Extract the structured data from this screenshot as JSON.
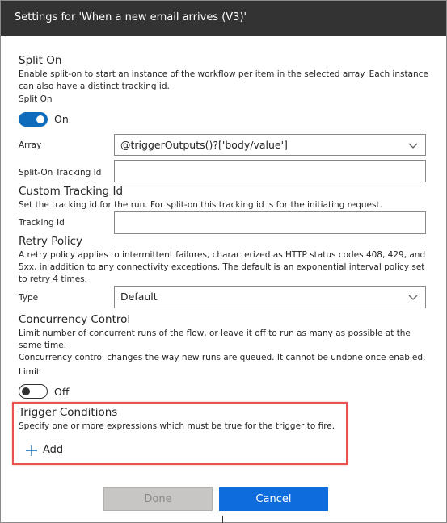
{
  "dialog": {
    "title": "Settings for 'When a new email arrives (V3)'"
  },
  "split_on": {
    "heading": "Split On",
    "description": "Enable split-on to start an instance of the workflow per item in the selected array. Each instance can also have a distinct tracking id.",
    "toggle_label": "Split On",
    "toggle_state": "On",
    "array_label": "Array",
    "array_value": "@triggerOutputs()?['body/value']",
    "tracking_label": "Split-On Tracking Id",
    "tracking_value": ""
  },
  "custom_tracking": {
    "heading": "Custom Tracking Id",
    "description": "Set the tracking id for the run. For split-on this tracking id is for the initiating request.",
    "field_label": "Tracking Id",
    "field_value": ""
  },
  "retry_policy": {
    "heading": "Retry Policy",
    "description": "A retry policy applies to intermittent failures, characterized as HTTP status codes 408, 429, and 5xx, in addition to any connectivity exceptions. The default is an exponential interval policy set to retry 4 times.",
    "type_label": "Type",
    "type_value": "Default"
  },
  "concurrency": {
    "heading": "Concurrency Control",
    "description_1": "Limit number of concurrent runs of the flow, or leave it off to run as many as possible at the same time.",
    "description_2": "Concurrency control changes the way new runs are queued. It cannot be undone once enabled.",
    "limit_label": "Limit",
    "toggle_state": "Off"
  },
  "trigger_conditions": {
    "heading": "Trigger Conditions",
    "description": "Specify one or more expressions which must be true for the trigger to fire.",
    "add_label": "Add"
  },
  "footer": {
    "done_label": "Done",
    "cancel_label": "Cancel"
  },
  "colors": {
    "titlebar": "#333333",
    "accent": "#0f6cbd",
    "highlight": "#e8534f"
  },
  "icons": {
    "array_dropdown": "chevron-down-icon",
    "type_dropdown": "chevron-down-icon",
    "add": "plus-icon"
  }
}
